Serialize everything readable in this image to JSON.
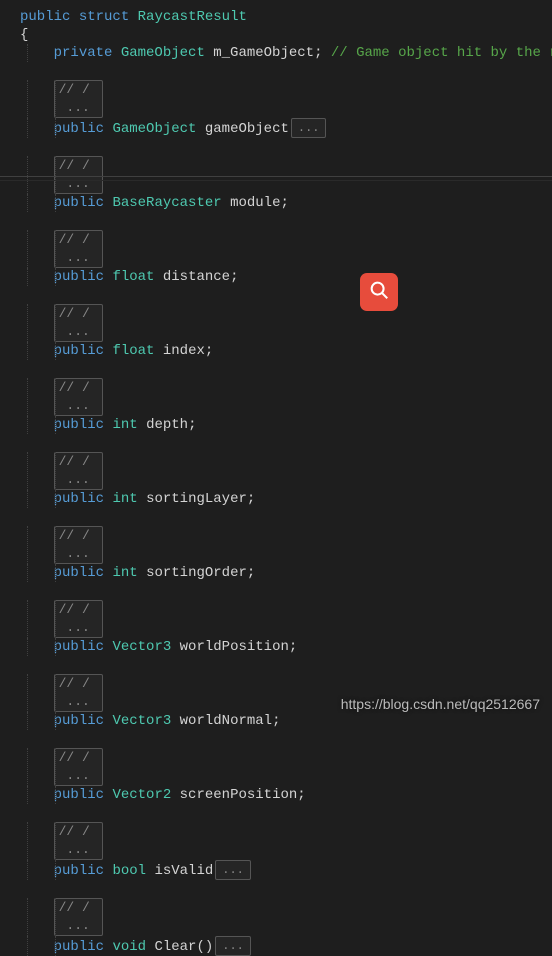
{
  "struct": {
    "kw_public": "public",
    "kw_struct": "struct",
    "name": "RaycastResult",
    "brace_open": "{",
    "m_gameObject": {
      "mod": "private",
      "type": "GameObject",
      "name": "m_GameObject",
      "semi": ";",
      "comment": "// Game object hit by the raycast"
    },
    "summary": "// / <summary> ...",
    "ellipsis": "...",
    "members": [
      {
        "mod": "public",
        "type": "GameObject",
        "name": "gameObject",
        "semi": "",
        "collapse": true
      },
      {
        "mod": "public",
        "type": "BaseRaycaster",
        "name": "module",
        "semi": ";",
        "collapse": false
      },
      {
        "mod": "public",
        "type": "float",
        "name": "distance",
        "semi": ";",
        "collapse": false
      },
      {
        "mod": "public",
        "type": "float",
        "name": "index",
        "semi": ";",
        "collapse": false
      },
      {
        "mod": "public",
        "type": "int",
        "name": "depth",
        "semi": ";",
        "collapse": false
      },
      {
        "mod": "public",
        "type": "int",
        "name": "sortingLayer",
        "semi": ";",
        "collapse": false
      },
      {
        "mod": "public",
        "type": "int",
        "name": "sortingOrder",
        "semi": ";",
        "collapse": false
      },
      {
        "mod": "public",
        "type": "Vector3",
        "name": "worldPosition",
        "semi": ";",
        "collapse": false
      },
      {
        "mod": "public",
        "type": "Vector3",
        "name": "worldNormal",
        "semi": ";",
        "collapse": false
      },
      {
        "mod": "public",
        "type": "Vector2",
        "name": "screenPosition",
        "semi": ";",
        "collapse": false
      },
      {
        "mod": "public",
        "type": "bool",
        "name": "isValid",
        "semi": "",
        "collapse": true
      },
      {
        "mod": "public",
        "type": "void",
        "name": "Clear()",
        "semi": "",
        "collapse": true
      }
    ]
  },
  "watermark": "https://blog.csdn.net/qq2512667"
}
